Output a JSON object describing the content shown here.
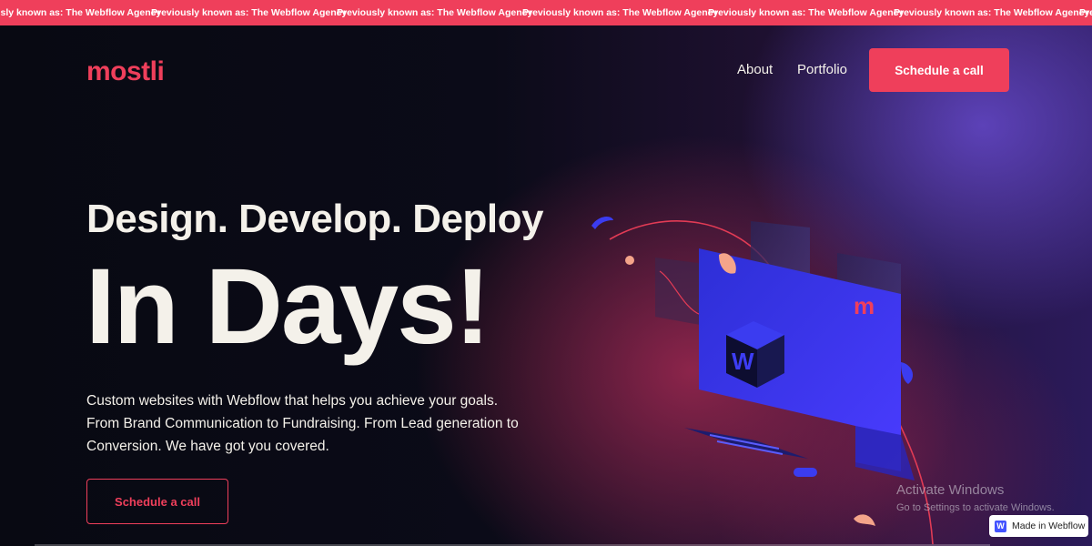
{
  "marquee": {
    "items": [
      "Previously known as: The Webflow Agency",
      "Previously known as: The Webflow Agency",
      "Previously known as: The Webflow Agency",
      "Previously known as: The Webflow Agency",
      "Previously known as: The Webflow Agency",
      "Previously known as: The Webflow Agency",
      "Previously known as: The Webflow Agency"
    ]
  },
  "header": {
    "logo": "mostli",
    "nav": [
      "About",
      "Portfolio"
    ],
    "cta_label": "Schedule a call"
  },
  "hero": {
    "headline": "Design. Develop. Deploy",
    "big_text": "In Days!",
    "description_lines": [
      "Custom websites with Webflow that helps you achieve your goals.",
      "From Brand Communication to Fundraising. From Lead generation to",
      "Conversion. We have got you covered."
    ],
    "cta_label": "Schedule a call"
  },
  "illustration": {
    "cube_letter": "W",
    "panel_letter": "m"
  },
  "watermark": {
    "title": "Activate Windows",
    "subtitle": "Go to Settings to activate Windows."
  },
  "badge": {
    "icon": "W",
    "label": "Made in Webflow"
  },
  "colors": {
    "accent": "#ef3f5b",
    "text": "#f4f1ea",
    "background": "#090a14",
    "panel_blue": "#3b3cf0"
  }
}
